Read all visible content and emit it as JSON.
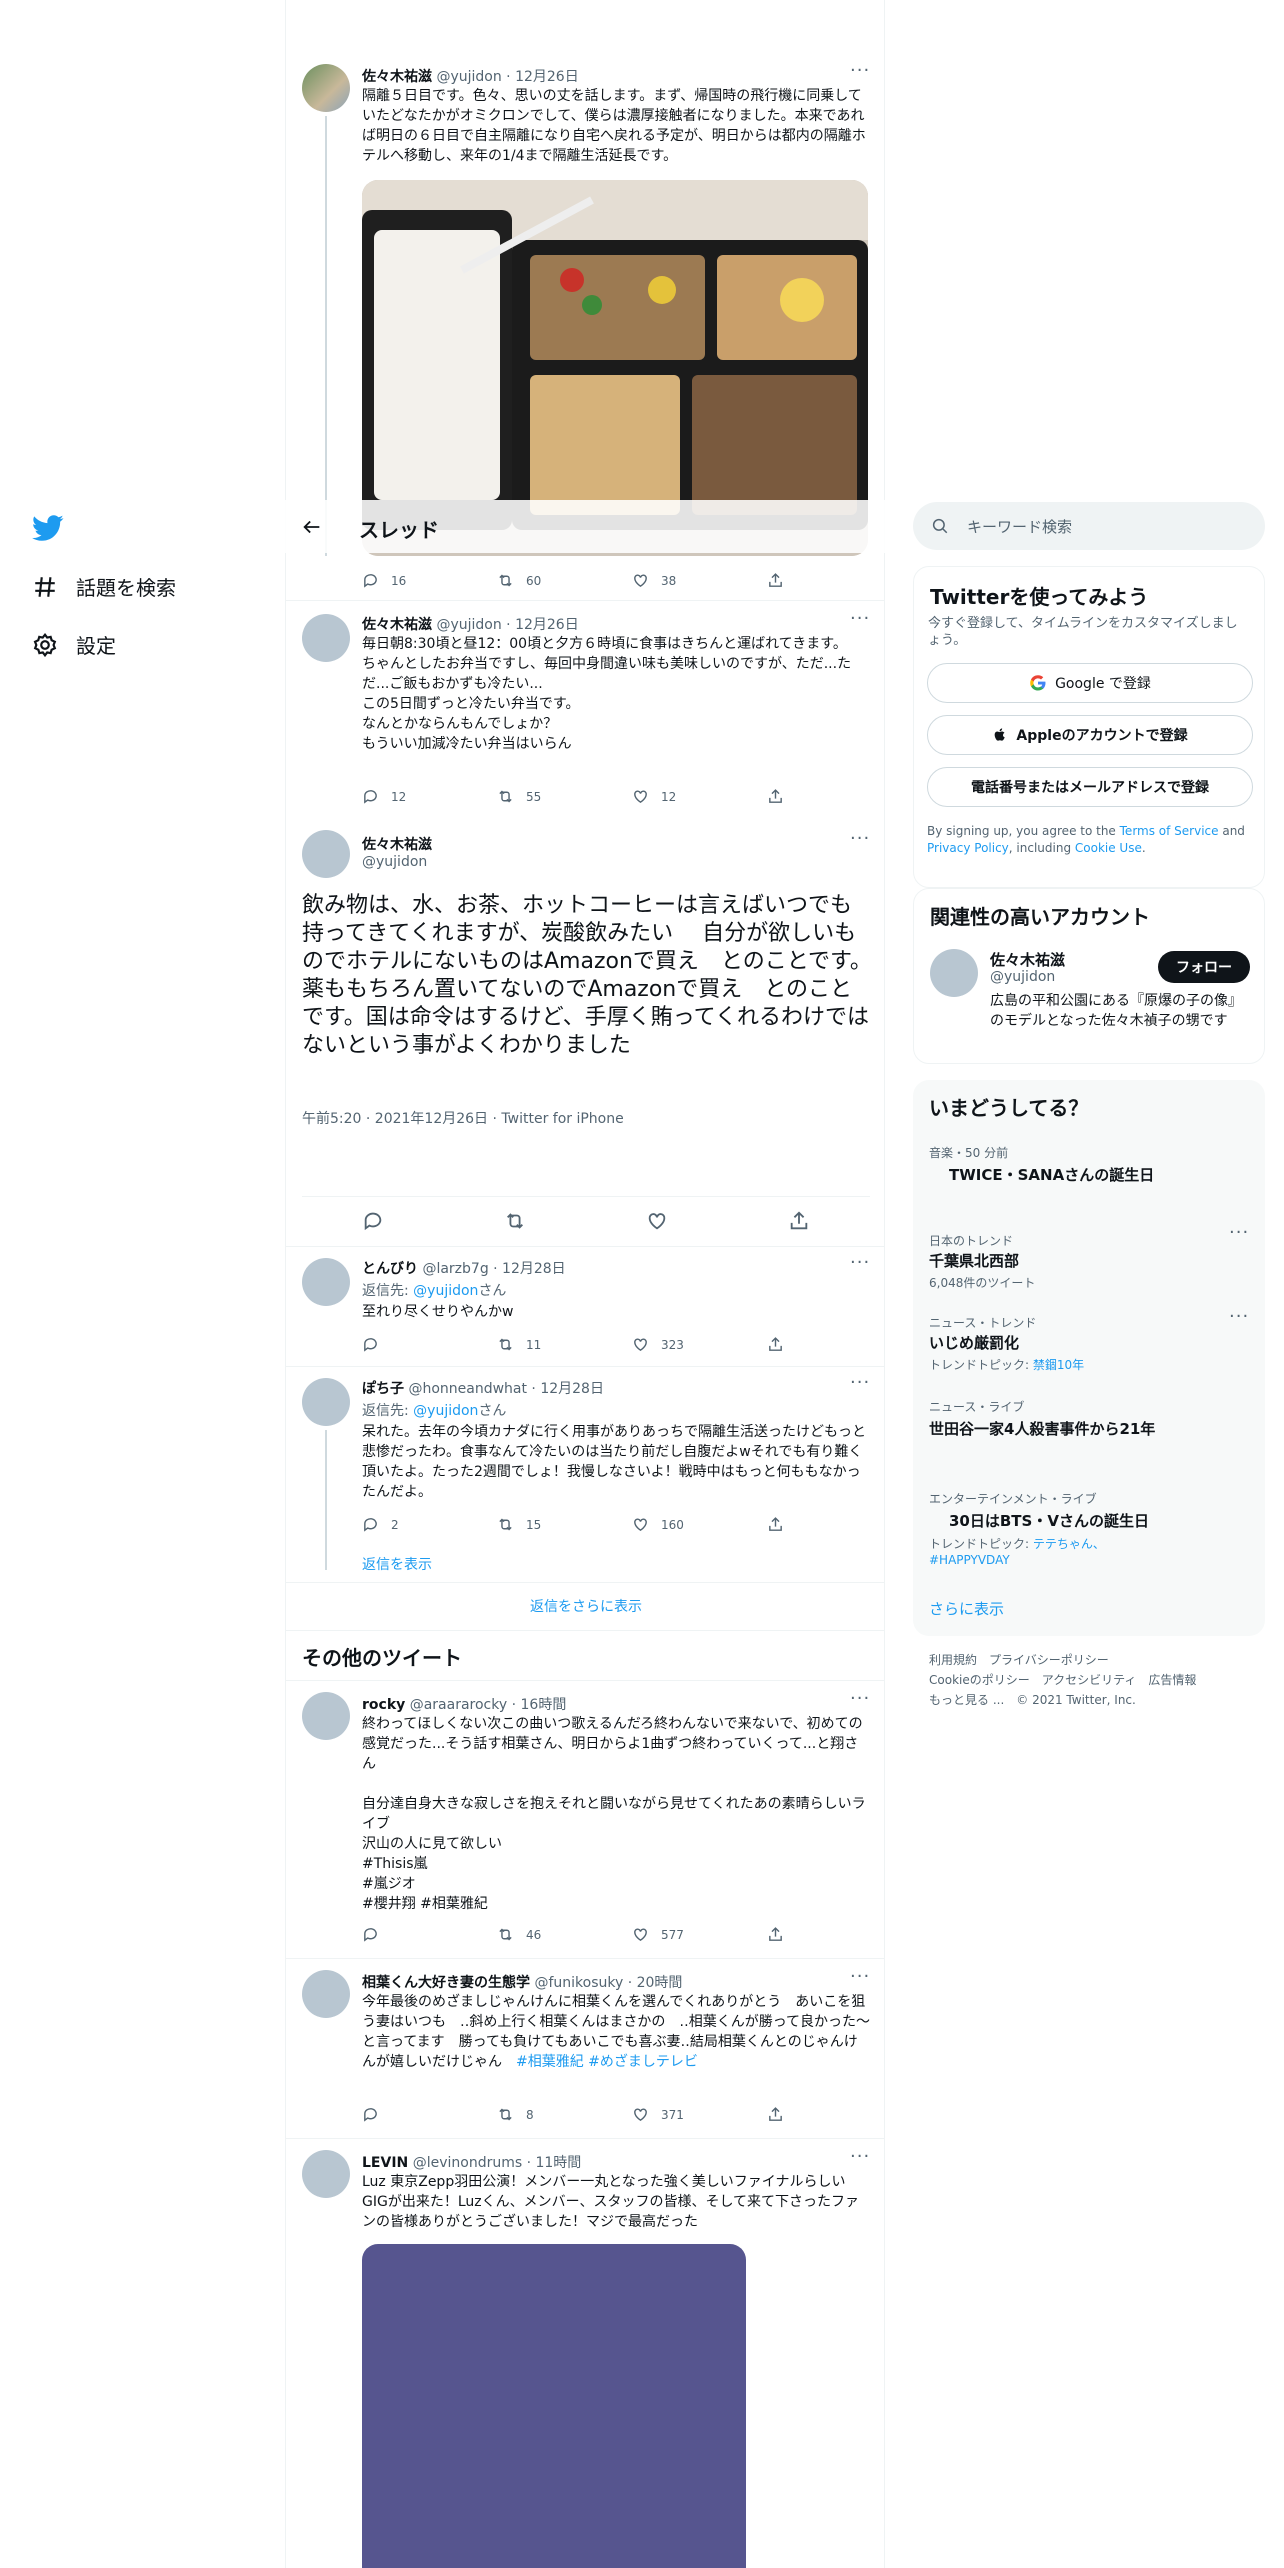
{
  "nav": {
    "items": [
      {
        "label": "話題を検索",
        "icon": "hashtag-icon"
      },
      {
        "label": "設定",
        "icon": "gear-icon"
      }
    ]
  },
  "header": {
    "title": "スレッド"
  },
  "tweets": [
    {
      "name": "佐々木祐滋",
      "meta": "@yujidon · 12月26日",
      "text": "隔離５日目です。色々、思いの丈を話します。まず、帰国時の飛行機に同乗していたどなたかがオミクロンでして、僕らは濃厚接触者になりました。本来であれば明日の６日目で自主隔離になり自宅へ戻れる予定が、明日からは都内の隔離ホテルへ移動し、来年の1/4まで隔離生活延長です。",
      "reply": "16",
      "retweet": "60",
      "like": "38"
    },
    {
      "name": "佐々木祐滋",
      "meta": "@yujidon · 12月26日",
      "text": "毎日朝8:30頃と昼12：00頃と夕方６時頃に食事はきちんと運ばれてきます。\nちゃんとしたお弁当ですし、毎回中身間違い味も美味しいのですが、ただ...ただ...ご飯もおかずも冷たい...\nこの5日間ずっと冷たい弁当です。\nなんとかならんもんでしょか？\nもういい加減冷たい弁当はいらん",
      "reply": "12",
      "retweet": "55",
      "like": "12"
    }
  ],
  "main_tweet": {
    "name": "佐々木祐滋",
    "handle": "@yujidon",
    "text": "飲み物は、水、お茶、ホットコーヒーは言えばいつでも持ってきてくれますが、炭酸飲みたい　 自分が欲しいものでホテルにないものはAmazonで買え　とのことです。薬ももちろん置いてないのでAmazonで買え　とのことです。国は命令はするけど、手厚く賄ってくれるわけではないという事がよくわかりました",
    "meta": "午前5:20 · 2021年12月26日 · Twitter for iPhone"
  },
  "replies": [
    {
      "name": "とんびり",
      "meta": "@larzb7g · 12月28日",
      "reply_to_prefix": "返信先: ",
      "reply_to": "@yujidon",
      "reply_to_suffix": "さん",
      "text": "至れり尽くせりやんかw",
      "reply": "",
      "retweet": "11",
      "like": "323"
    },
    {
      "name": "ぽち子",
      "meta": "@honneandwhat · 12月28日",
      "reply_to_prefix": "返信先: ",
      "reply_to": "@yujidon",
      "reply_to_suffix": "さん",
      "text": "呆れた。去年の今頃カナダに行く用事がありあっちで隔離生活送ったけどもっと悲惨だったわ。食事なんて冷たいのは当たり前だし自腹だよwそれでも有り難く頂いたよ。たった2週間でしょ！我慢しなさいよ！戦時中はもっと何ももなかったんだよ。",
      "reply": "2",
      "retweet": "15",
      "like": "160"
    }
  ],
  "show_replies": "返信を表示",
  "show_more_replies": "返信をさらに表示",
  "other_tweets_title": "その他のツイート",
  "other_tweets": [
    {
      "name": "rocky",
      "meta": "@araararocky · 16時間",
      "text": "終わってほしくない次この曲いつ歌えるんだろ終わんないで来ないで、初めての感覚だった...そう話す相葉さん、明日からよ1曲ずつ終わっていくって...と翔さん\n\n自分達自身大きな寂しさを抱えそれと闘いながら見せてくれたあの素晴らしいライブ\n沢山の人に見て欲しい",
      "tags": [
        "#Thisis嵐",
        "#嵐ジオ",
        "#櫻井翔 #相葉雅紀"
      ],
      "reply": "",
      "retweet": "46",
      "like": "577"
    },
    {
      "name": "相葉くん大好き妻の生態学",
      "meta": "@funikosuky · 20時間",
      "text": "今年最後のめざましじゃんけんに相葉くんを選んでくれありがとう　あいこを狙う妻はいつも　‥斜め上行く相葉くんはまさかの　‥相葉くんが勝って良かった〜と言ってます　勝っても負けてもあいこでも喜ぶ妻‥結局相葉くんとのじゃんけんが嬉しいだけじゃん　",
      "tags_inline": "#相葉雅紀 #めざましテレビ",
      "reply": "",
      "retweet": "8",
      "like": "371"
    },
    {
      "name": "LEVIN",
      "meta": "@levinondrums · 11時間",
      "text": "Luz 東京Zepp羽田公演！メンバー一丸となった強く美しいファイナルらしいGIGが出来た！Luzくん、メンバー、スタッフの皆様、そして来て下さったファンの皆様ありがとうございました！マジで最高だった"
    }
  ],
  "right": {
    "search_placeholder": "キーワード検索",
    "signup": {
      "title": "Twitterを使ってみよう",
      "subtitle": "今すぐ登録して、タイムラインをカスタマイズしましょう。",
      "google": "Google で登録",
      "apple": "Appleのアカウントで登録",
      "phone": "電話番号またはメールアドレスで登録",
      "terms_prefix": "By signing up, you agree to the ",
      "terms": "Terms of Service",
      "and": " and ",
      "privacy": "Privacy Policy",
      "including": ", including ",
      "cookie": "Cookie Use",
      "period": "."
    },
    "related": {
      "title": "関連性の高いアカウント",
      "name": "佐々木祐滋",
      "handle": "@yujidon",
      "follow": "フォロー",
      "bio": "広島の平和公園にある『原爆の子の像』のモデルとなった佐々木禎子の甥です"
    },
    "trends": {
      "title": "いまどうしてる？",
      "items": [
        {
          "label": "音楽・50 分前",
          "title": "TWICE・SANAさんの誕生日"
        },
        {
          "label": "日本のトレンド",
          "title": "千葉県北西部",
          "sub": "6,048件のツイート"
        },
        {
          "label": "ニュース・トレンド",
          "title": "いじめ厳罰化",
          "sub_prefix": "トレンドトピック: ",
          "sub_link": "禁錮10年"
        },
        {
          "label": "ニュース・ライブ",
          "title": "世田谷一家4人殺害事件から21年"
        },
        {
          "label": "エンターテインメント・ライブ",
          "title": "30日はBTS・Vさんの誕生日",
          "sub_prefix": "トレンドトピック: ",
          "sub_link": "テテちゃん、#HAPPYVDAY"
        }
      ],
      "show_more": "さらに表示"
    },
    "footer": {
      "line1": "利用規約　プライバシーポリシー",
      "line2": "Cookieのポリシー　アクセシビリティ　広告情報",
      "line3": "もっと見る ...　© 2021 Twitter, Inc."
    }
  }
}
